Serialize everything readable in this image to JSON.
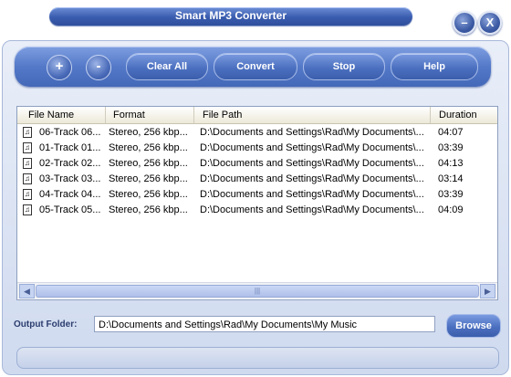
{
  "window": {
    "title": "Smart MP3 Converter",
    "minimize_label": "–",
    "close_label": "X"
  },
  "toolbar": {
    "add_label": "+",
    "remove_label": "-",
    "clear_label": "Clear All",
    "convert_label": "Convert",
    "stop_label": "Stop",
    "help_label": "Help"
  },
  "list": {
    "columns": [
      "File Name",
      "Format",
      "File Path",
      "Duration"
    ],
    "rows": [
      {
        "name": "06-Track 06...",
        "format": "Stereo, 256 kbp...",
        "path": "D:\\Documents and Settings\\Rad\\My Documents\\...",
        "duration": "04:07"
      },
      {
        "name": "01-Track 01...",
        "format": "Stereo, 256 kbp...",
        "path": "D:\\Documents and Settings\\Rad\\My Documents\\...",
        "duration": "03:39"
      },
      {
        "name": "02-Track 02...",
        "format": "Stereo, 256 kbp...",
        "path": "D:\\Documents and Settings\\Rad\\My Documents\\...",
        "duration": "04:13"
      },
      {
        "name": "03-Track 03...",
        "format": "Stereo, 256 kbp...",
        "path": "D:\\Documents and Settings\\Rad\\My Documents\\...",
        "duration": "03:14"
      },
      {
        "name": "04-Track 04...",
        "format": "Stereo, 256 kbp...",
        "path": "D:\\Documents and Settings\\Rad\\My Documents\\...",
        "duration": "03:39"
      },
      {
        "name": "05-Track 05...",
        "format": "Stereo, 256 kbp...",
        "path": "D:\\Documents and Settings\\Rad\\My Documents\\...",
        "duration": "04:09"
      }
    ],
    "icon": "music-file-icon"
  },
  "output": {
    "label": "Output Folder:",
    "value": "D:\\Documents and Settings\\Rad\\My Documents\\My Music",
    "browse_label": "Browse"
  },
  "colors": {
    "accent": "#4c70c0",
    "frame": "#cfdaef"
  }
}
